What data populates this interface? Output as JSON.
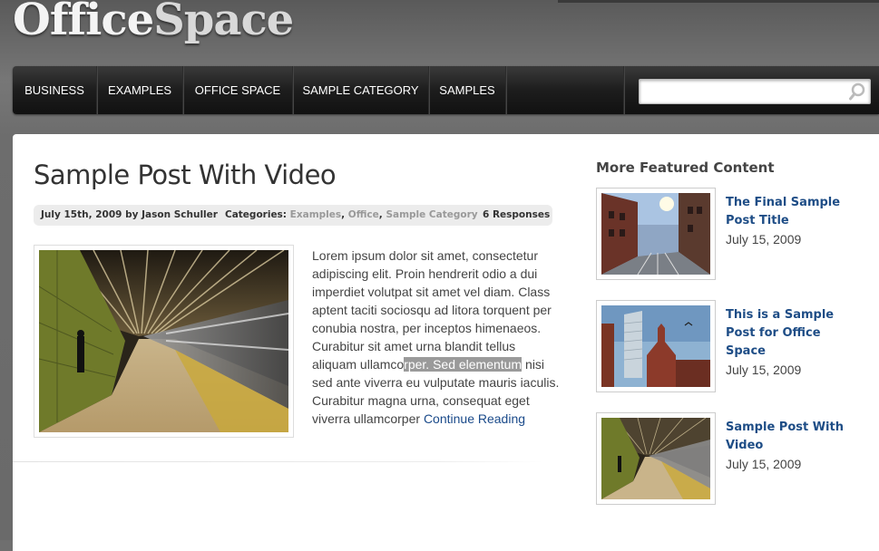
{
  "site": {
    "logo_part1": "Office",
    "logo_part2": "Space"
  },
  "nav": {
    "items": [
      {
        "label": "BUSINESS"
      },
      {
        "label": "EXAMPLES"
      },
      {
        "label": "OFFICE SPACE"
      },
      {
        "label": "SAMPLE CATEGORY"
      },
      {
        "label": "SAMPLES"
      }
    ]
  },
  "search": {
    "value": "",
    "placeholder": "",
    "icon": "search-icon"
  },
  "post": {
    "title": "Sample Post With Video",
    "date_author": "July 15th, 2009 by Jason Schuller",
    "categories_label": "Categories:",
    "categories": [
      "Examples",
      "Office",
      "Sample Category"
    ],
    "responses": "6 Responses",
    "excerpt_lines": [
      "Lorem ipsum dolor sit amet, consectetur",
      "adipiscing elit. Proin hendrerit odio a dui",
      "imperdiet volutpat sit amet vel diam. Class",
      "aptent taciti sociosqu ad litora torquent per",
      "conubia nostra, per inceptos himenaeos.",
      "Curabitur sit amet urna blandit tellus"
    ],
    "excerpt_sel_before": "aliquam ullamco",
    "excerpt_sel": "rper. Sed elementum",
    "excerpt_sel_after": " nisi",
    "excerpt_lines_after": [
      "sed ante viverra eu vulputate mauris iaculis.",
      "Curabitur magna urna, consequat eget"
    ],
    "excerpt_last": "viverra ullamcorper ",
    "continue_label": "Continue Reading"
  },
  "sidebar": {
    "heading": "More Featured Content",
    "items": [
      {
        "title_line1": "The Final Sample",
        "title_line2": "Post Title",
        "title_line3": "",
        "date": "July 15, 2009"
      },
      {
        "title_line1": "This is a Sample",
        "title_line2": "Post for Office",
        "title_line3": "Space",
        "date": "July 15, 2009"
      },
      {
        "title_line1": "Sample Post With",
        "title_line2": "Video",
        "title_line3": "",
        "date": "July 15, 2009"
      }
    ]
  },
  "colors": {
    "link": "#1a4a8a",
    "sidebar_link": "#1e4d86",
    "nav_bg": "#1d1d1d"
  }
}
